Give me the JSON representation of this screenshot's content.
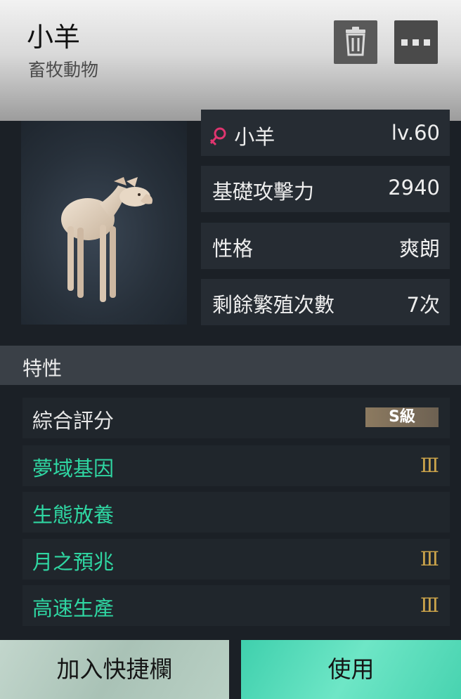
{
  "header": {
    "title": "小羊",
    "subtitle": "畜牧動物",
    "icons": {
      "delete": "trash-icon",
      "more": "more-icon"
    }
  },
  "pet": {
    "gender_icon": "female-icon",
    "name": "小羊",
    "level": "lv.60"
  },
  "stats": [
    {
      "label": "基礎攻擊力",
      "value": "2940"
    },
    {
      "label": "性格",
      "value": "爽朗"
    },
    {
      "label": "剩餘繁殖次數",
      "value": "7次"
    }
  ],
  "traits_section": {
    "title": "特性",
    "overall": {
      "label": "綜合評分",
      "grade": "S級"
    },
    "items": [
      {
        "label": "夢域基因",
        "tier": "III"
      },
      {
        "label": "生態放養",
        "tier": ""
      },
      {
        "label": "月之預兆",
        "tier": "III"
      },
      {
        "label": "高速生產",
        "tier": "III"
      }
    ]
  },
  "actions": {
    "shortcut": "加入快捷欄",
    "use": "使用"
  },
  "colors": {
    "accent_teal": "#2fd6a2",
    "tier_gold": "#c9a24a",
    "female_pink": "#e0356f"
  }
}
